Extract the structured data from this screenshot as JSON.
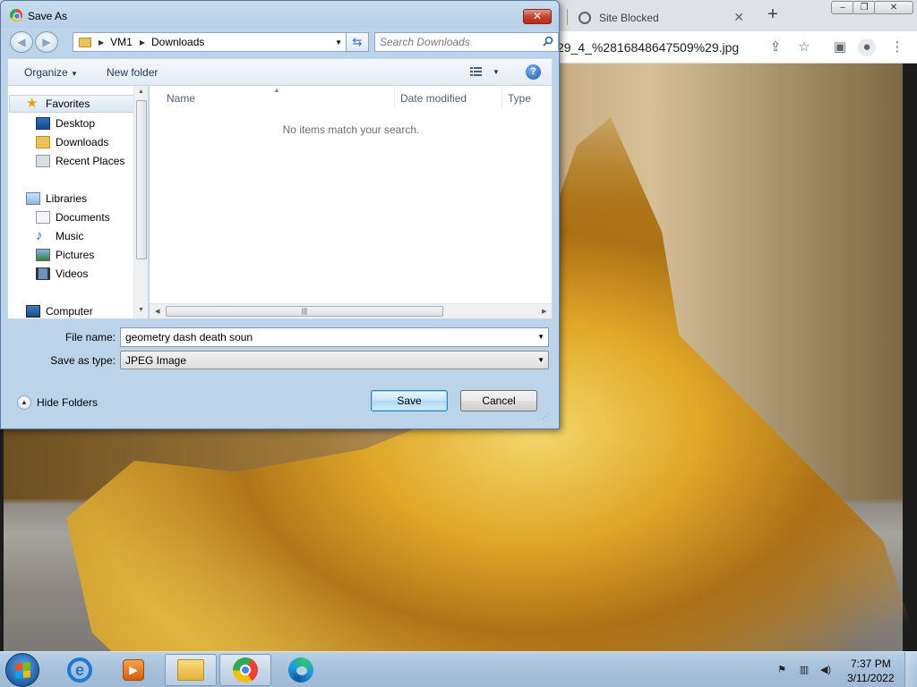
{
  "browser": {
    "tab_title": "Site Blocked",
    "url_fragment": "29_4_%2816848647509%29.jpg"
  },
  "dialog": {
    "title": "Save As",
    "breadcrumb": [
      "VM1",
      "Downloads"
    ],
    "search_placeholder": "Search Downloads",
    "organize_label": "Organize",
    "new_folder_label": "New folder",
    "nav": {
      "favorites": "Favorites",
      "desktop": "Desktop",
      "downloads": "Downloads",
      "recent_places": "Recent Places",
      "libraries": "Libraries",
      "documents": "Documents",
      "music": "Music",
      "pictures": "Pictures",
      "videos": "Videos",
      "computer": "Computer"
    },
    "columns": {
      "name": "Name",
      "date_modified": "Date modified",
      "type": "Type"
    },
    "empty_message": "No items match your search.",
    "file_name_label": "File name:",
    "file_name_value": "geometry dash death soun",
    "save_as_type_label": "Save as type:",
    "save_as_type_value": "JPEG Image",
    "hide_folders_label": "Hide Folders",
    "save_label": "Save",
    "cancel_label": "Cancel"
  },
  "taskbar": {
    "time": "7:37 PM",
    "date": "3/11/2022"
  }
}
